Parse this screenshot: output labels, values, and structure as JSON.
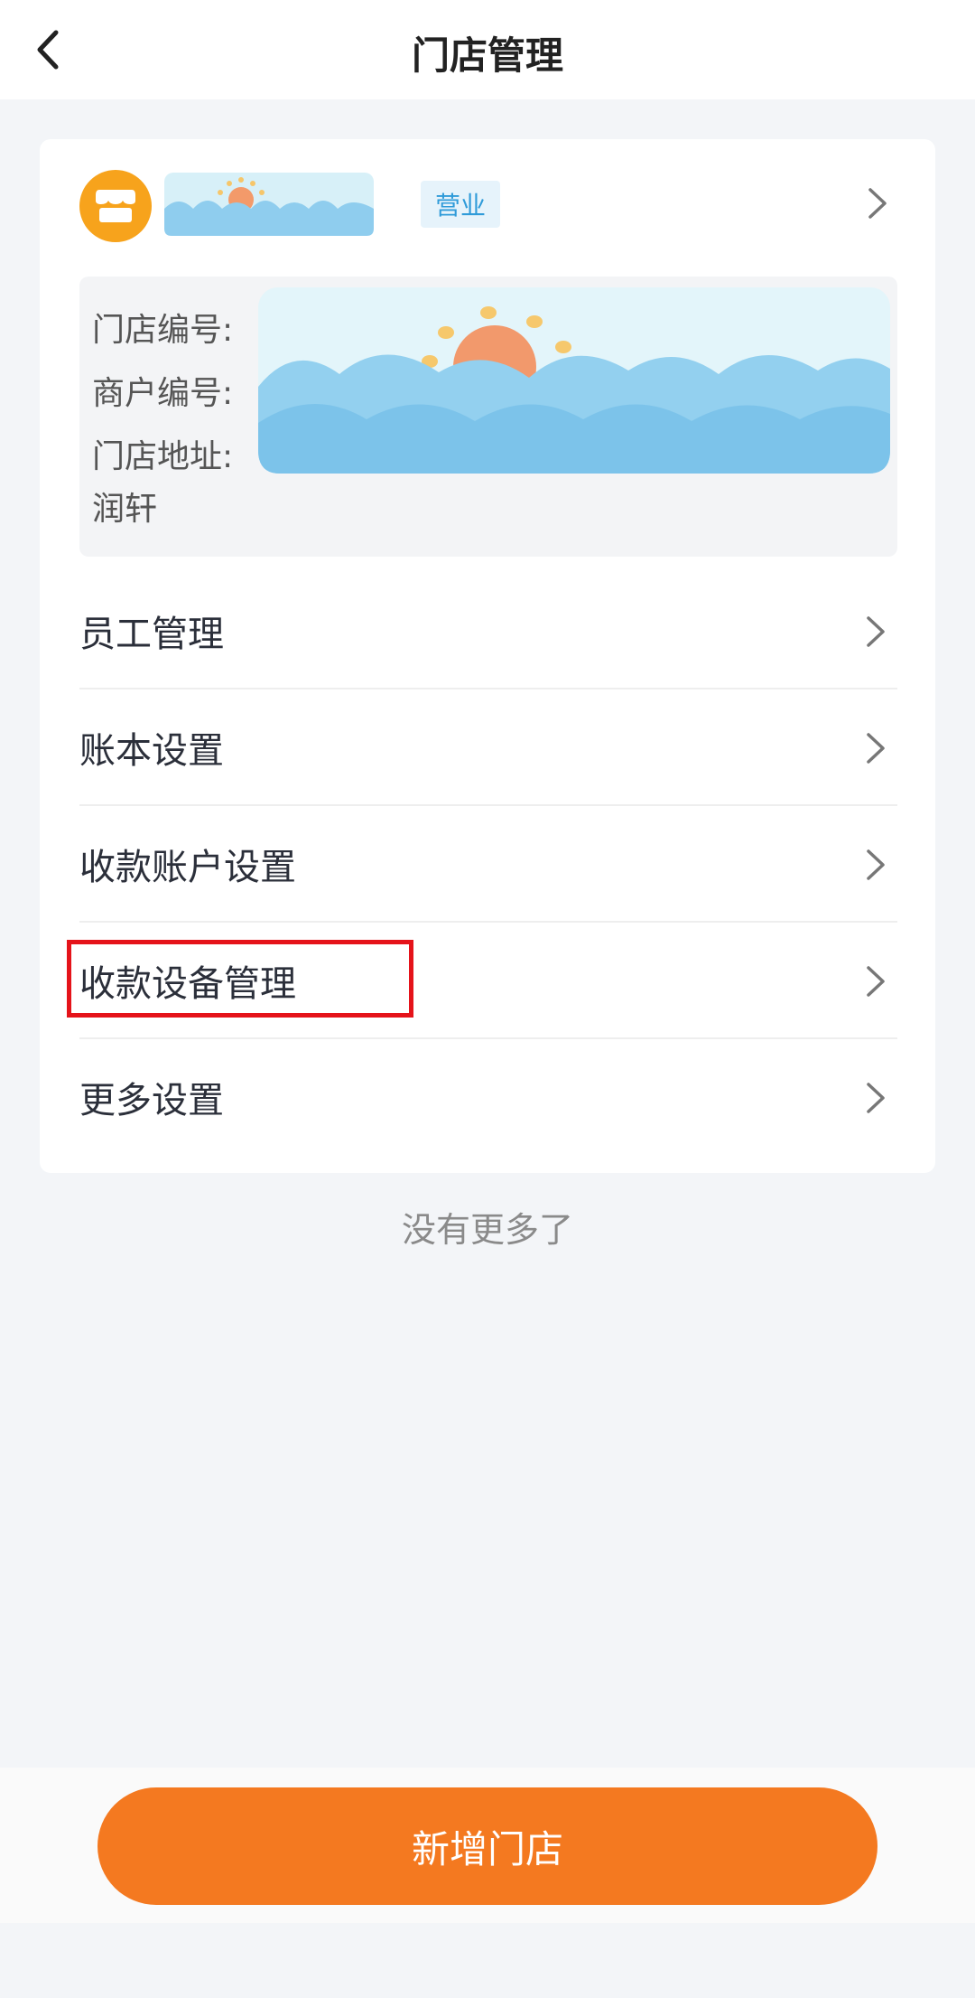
{
  "header": {
    "title": "门店管理"
  },
  "store": {
    "status": "营业",
    "info": {
      "store_no_label": "门店编号:",
      "merchant_no_label": "商户编号:",
      "address_label": "门店地址:",
      "address_tail": "润轩"
    }
  },
  "menu": [
    {
      "label": "员工管理"
    },
    {
      "label": "账本设置"
    },
    {
      "label": "收款账户设置"
    },
    {
      "label": "收款设备管理"
    },
    {
      "label": "更多设置"
    }
  ],
  "footer_note": "没有更多了",
  "add_store_label": "新增门店",
  "colors": {
    "accent": "#f47920",
    "badge": "#2f9bd9",
    "highlight": "#e5131a"
  }
}
